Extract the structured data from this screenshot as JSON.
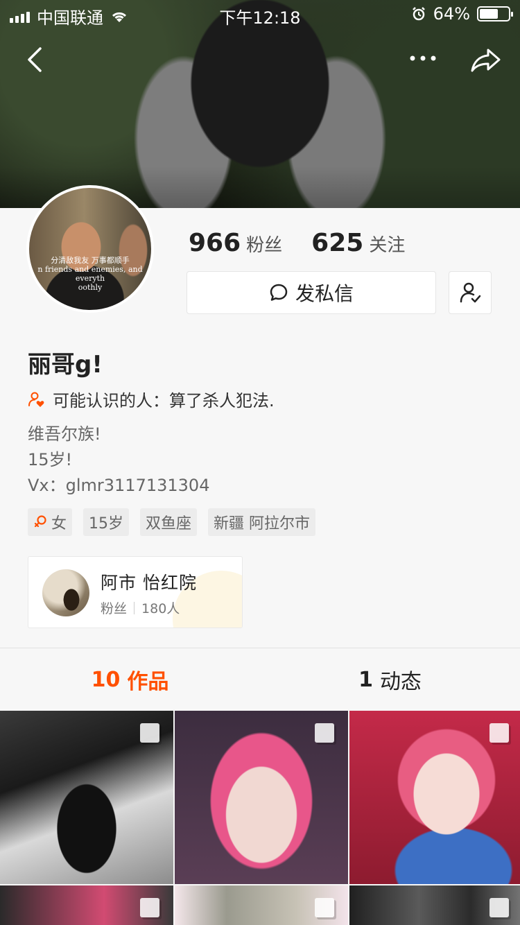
{
  "status_bar": {
    "carrier": "中国联通",
    "time": "下午12:18",
    "battery": "64%",
    "battery_level": 0.64
  },
  "profile": {
    "avatar_caption_1": "分清敌我友 万事都顺手",
    "avatar_caption_2": "n friends and enemies, and everyth",
    "avatar_caption_3": "oothly",
    "fans_count": "966",
    "fans_label": "粉丝",
    "following_count": "625",
    "following_label": "关注",
    "message_button": "发私信",
    "name": "丽哥g!",
    "maybe_know": "可能认识的人：算了杀人犯法.",
    "bio_lines": [
      "维吾尔族!",
      "15岁!",
      "Vx：glmr3117131304"
    ],
    "tags": [
      "女",
      "15岁",
      "双鱼座",
      "新疆 阿拉尔市"
    ]
  },
  "group": {
    "name": "阿市  怡红院",
    "fans_label": "粉丝",
    "fans_count": "180人"
  },
  "tabs": {
    "works_count": "10",
    "works_label": "作品",
    "moments_count": "1",
    "moments_label": "动态"
  },
  "colors": {
    "accent": "#ff5000",
    "background": "#f7f7f7"
  }
}
